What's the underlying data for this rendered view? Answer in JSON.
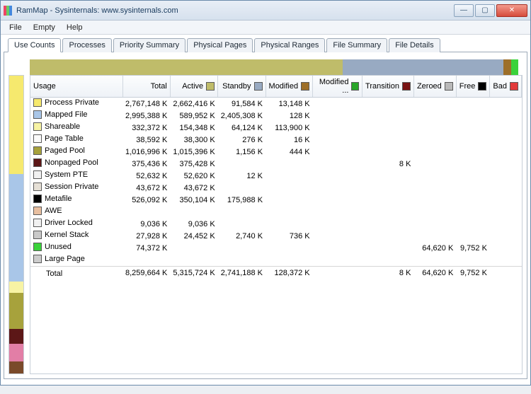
{
  "window": {
    "title": "RamMap - Sysinternals: www.sysinternals.com"
  },
  "menu": {
    "file": "File",
    "empty": "Empty",
    "help": "Help"
  },
  "tabs": {
    "use_counts": "Use Counts",
    "processes": "Processes",
    "priority_summary": "Priority Summary",
    "physical_pages": "Physical Pages",
    "physical_ranges": "Physical Ranges",
    "file_summary": "File Summary",
    "file_details": "File Details"
  },
  "columns": {
    "usage": "Usage",
    "total": "Total",
    "active": "Active",
    "standby": "Standby",
    "modified": "Modified",
    "modifiednw": "Modified ...",
    "transition": "Transition",
    "zeroed": "Zeroed",
    "free": "Free",
    "bad": "Bad"
  },
  "col_colors": {
    "active": "#bfbc6a",
    "standby": "#98aac2",
    "modified": "#9d6f29",
    "modifiednw": "#2aa62a",
    "transition": "#7a1414",
    "zeroed": "#b9b9b9",
    "free": "#000000",
    "bad": "#e23a3a"
  },
  "row_colors": [
    "#f6e96e",
    "#a9c6e8",
    "#f7f3a4",
    "#fbfbfb",
    "#a7a23c",
    "#5c1717",
    "#f1f1f1",
    "#e6e0d6",
    "#000000",
    "#e8bfa0",
    "#f1f1f1",
    "#c9c9c9",
    "#3ad23a"
  ],
  "rows": [
    {
      "label": "Process Private",
      "total": "2,767,148 K",
      "active": "2,662,416 K",
      "standby": "91,584 K",
      "modified": "13,148 K",
      "modifiednw": "",
      "transition": "",
      "zeroed": "",
      "free": "",
      "bad": ""
    },
    {
      "label": "Mapped File",
      "total": "2,995,388 K",
      "active": "589,952 K",
      "standby": "2,405,308 K",
      "modified": "128 K",
      "modifiednw": "",
      "transition": "",
      "zeroed": "",
      "free": "",
      "bad": ""
    },
    {
      "label": "Shareable",
      "total": "332,372 K",
      "active": "154,348 K",
      "standby": "64,124 K",
      "modified": "113,900 K",
      "modifiednw": "",
      "transition": "",
      "zeroed": "",
      "free": "",
      "bad": ""
    },
    {
      "label": "Page Table",
      "total": "38,592 K",
      "active": "38,300 K",
      "standby": "276 K",
      "modified": "16 K",
      "modifiednw": "",
      "transition": "",
      "zeroed": "",
      "free": "",
      "bad": ""
    },
    {
      "label": "Paged Pool",
      "total": "1,016,996 K",
      "active": "1,015,396 K",
      "standby": "1,156 K",
      "modified": "444 K",
      "modifiednw": "",
      "transition": "",
      "zeroed": "",
      "free": "",
      "bad": ""
    },
    {
      "label": "Nonpaged Pool",
      "total": "375,436 K",
      "active": "375,428 K",
      "standby": "",
      "modified": "",
      "modifiednw": "",
      "transition": "8 K",
      "zeroed": "",
      "free": "",
      "bad": ""
    },
    {
      "label": "System PTE",
      "total": "52,632 K",
      "active": "52,620 K",
      "standby": "12 K",
      "modified": "",
      "modifiednw": "",
      "transition": "",
      "zeroed": "",
      "free": "",
      "bad": ""
    },
    {
      "label": "Session Private",
      "total": "43,672 K",
      "active": "43,672 K",
      "standby": "",
      "modified": "",
      "modifiednw": "",
      "transition": "",
      "zeroed": "",
      "free": "",
      "bad": ""
    },
    {
      "label": "Metafile",
      "total": "526,092 K",
      "active": "350,104 K",
      "standby": "175,988 K",
      "modified": "",
      "modifiednw": "",
      "transition": "",
      "zeroed": "",
      "free": "",
      "bad": ""
    },
    {
      "label": "AWE",
      "total": "",
      "active": "",
      "standby": "",
      "modified": "",
      "modifiednw": "",
      "transition": "",
      "zeroed": "",
      "free": "",
      "bad": ""
    },
    {
      "label": "Driver Locked",
      "total": "9,036 K",
      "active": "9,036 K",
      "standby": "",
      "modified": "",
      "modifiednw": "",
      "transition": "",
      "zeroed": "",
      "free": "",
      "bad": ""
    },
    {
      "label": "Kernel Stack",
      "total": "27,928 K",
      "active": "24,452 K",
      "standby": "2,740 K",
      "modified": "736 K",
      "modifiednw": "",
      "transition": "",
      "zeroed": "",
      "free": "",
      "bad": ""
    },
    {
      "label": "Unused",
      "total": "74,372 K",
      "active": "",
      "standby": "",
      "modified": "",
      "modifiednw": "",
      "transition": "",
      "zeroed": "64,620 K",
      "free": "9,752 K",
      "bad": ""
    },
    {
      "label": "Large Page",
      "total": "",
      "active": "",
      "standby": "",
      "modified": "",
      "modifiednw": "",
      "transition": "",
      "zeroed": "",
      "free": "",
      "bad": ""
    }
  ],
  "total_row": {
    "label": "Total",
    "total": "8,259,664 K",
    "active": "5,315,724 K",
    "standby": "2,741,188 K",
    "modified": "128,372 K",
    "modifiednw": "",
    "transition": "8 K",
    "zeroed": "64,620 K",
    "free": "9,752 K",
    "bad": ""
  },
  "topbar_segments": [
    {
      "color": "#bfbc6a",
      "flex": 64
    },
    {
      "color": "#98aac2",
      "flex": 33
    },
    {
      "color": "#9d6f29",
      "flex": 1.5
    },
    {
      "color": "#3ad23a",
      "flex": 1.5
    }
  ],
  "leftbar_segments": [
    {
      "color": "#f6e96e",
      "flex": 33
    },
    {
      "color": "#a9c6e8",
      "flex": 36
    },
    {
      "color": "#f7f3a4",
      "flex": 4
    },
    {
      "color": "#a7a23c",
      "flex": 12
    },
    {
      "color": "#5c1717",
      "flex": 5
    },
    {
      "color": "#e27ea6",
      "flex": 6
    },
    {
      "color": "#7a4a2a",
      "flex": 4
    }
  ]
}
